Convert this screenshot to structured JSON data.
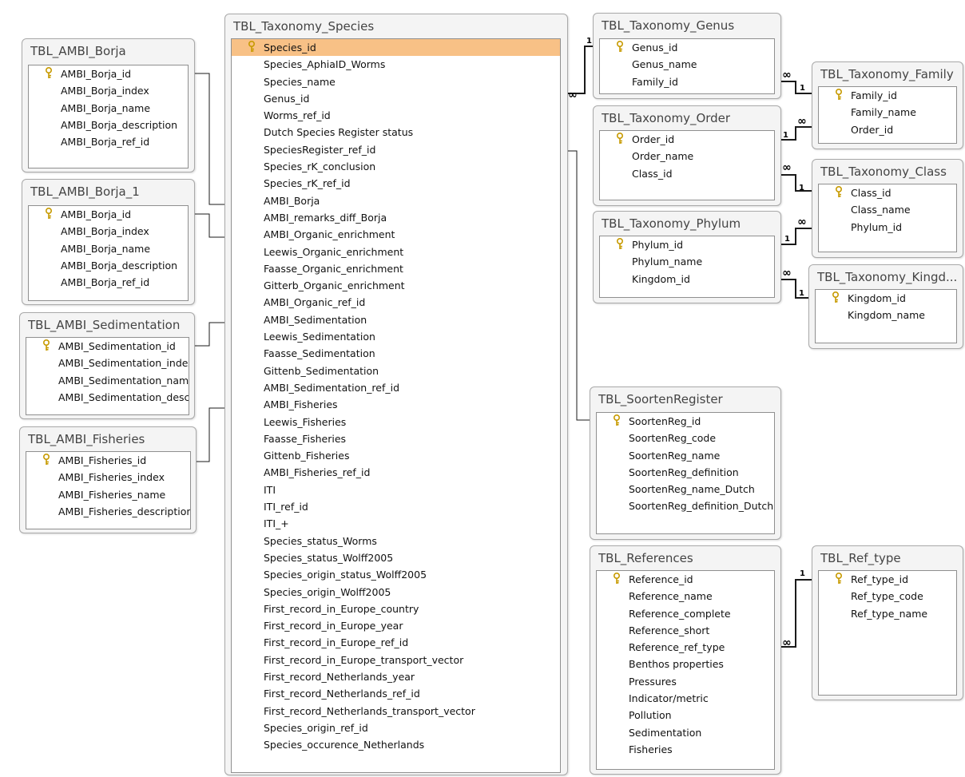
{
  "tables": {
    "species": {
      "title": "TBL_Taxonomy_Species",
      "fields": [
        "Species_id",
        "Species_AphiaID_Worms",
        "Species_name",
        "Genus_id",
        "Worms_ref_id",
        "Dutch Species Register status",
        "SpeciesRegister_ref_id",
        "Species_rK_conclusion",
        "Species_rK_ref_id",
        "AMBI_Borja",
        "AMBI_remarks_diff_Borja",
        "AMBI_Organic_enrichment",
        "Leewis_Organic_enrichment",
        "Faasse_Organic_enrichment",
        "Gitterb_Organic_enrichment",
        "AMBI_Organic_ref_id",
        "AMBI_Sedimentation",
        "Leewis_Sedimentation",
        "Faasse_Sedimentation",
        "Gittenb_Sedimentation",
        "AMBI_Sedimentation_ref_id",
        "AMBI_Fisheries",
        "Leewis_Fisheries",
        "Faasse_Fisheries",
        "Gittenb_Fisheries",
        "AMBI_Fisheries_ref_id",
        "ITI",
        "ITI_ref_id",
        "ITI_+",
        "Species_status_Worms",
        "Species_status_Wolff2005",
        "Species_origin_status_Wolff2005",
        "Species_origin_Wolff2005",
        "First_record_in_Europe_country",
        "First_record_in_Europe_year",
        "First_record_in_Europe_ref_id",
        "First_record_in_Europe_transport_vector",
        "First_record_Netherlands_year",
        "First_record_Netherlands_ref_id",
        "First_record_Netherlands_transport_vector",
        "Species_origin_ref_id",
        "Species_occurence_Netherlands"
      ]
    },
    "ambi_borja": {
      "title": "TBL_AMBI_Borja",
      "fields": [
        "AMBI_Borja_id",
        "AMBI_Borja_index",
        "AMBI_Borja_name",
        "AMBI_Borja_description",
        "AMBI_Borja_ref_id"
      ]
    },
    "ambi_borja_1": {
      "title": "TBL_AMBI_Borja_1",
      "fields": [
        "AMBI_Borja_id",
        "AMBI_Borja_index",
        "AMBI_Borja_name",
        "AMBI_Borja_description",
        "AMBI_Borja_ref_id"
      ]
    },
    "ambi_sedimentation": {
      "title": "TBL_AMBI_Sedimentation",
      "fields": [
        "AMBI_Sedimentation_id",
        "AMBI_Sedimentation_index",
        "AMBI_Sedimentation_name",
        "AMBI_Sedimentation_description"
      ]
    },
    "ambi_fisheries": {
      "title": "TBL_AMBI_Fisheries",
      "fields": [
        "AMBI_Fisheries_id",
        "AMBI_Fisheries_index",
        "AMBI_Fisheries_name",
        "AMBI_Fisheries_description"
      ]
    },
    "genus": {
      "title": "TBL_Taxonomy_Genus",
      "fields": [
        "Genus_id",
        "Genus_name",
        "Family_id"
      ]
    },
    "family": {
      "title": "TBL_Taxonomy_Family",
      "fields": [
        "Family_id",
        "Family_name",
        "Order_id"
      ]
    },
    "order": {
      "title": "TBL_Taxonomy_Order",
      "fields": [
        "Order_id",
        "Order_name",
        "Class_id"
      ]
    },
    "class": {
      "title": "TBL_Taxonomy_Class",
      "fields": [
        "Class_id",
        "Class_name",
        "Phylum_id"
      ]
    },
    "phylum": {
      "title": "TBL_Taxonomy_Phylum",
      "fields": [
        "Phylum_id",
        "Phylum_name",
        "Kingdom_id"
      ]
    },
    "kingdom": {
      "title": "TBL_Taxonomy_Kingd...",
      "fields": [
        "Kingdom_id",
        "Kingdom_name"
      ]
    },
    "soortenregister": {
      "title": "TBL_SoortenRegister",
      "fields": [
        "SoortenReg_id",
        "SoortenReg_code",
        "SoortenReg_name",
        "SoortenReg_definition",
        "SoortenReg_name_Dutch",
        "SoortenReg_definition_Dutch"
      ]
    },
    "references": {
      "title": "TBL_References",
      "fields": [
        "Reference_id",
        "Reference_name",
        "Reference_complete",
        "Reference_short",
        "Reference_ref_type",
        "Benthos properties",
        "Pressures",
        "Indicator/metric",
        "Pollution",
        "Sedimentation",
        "Fisheries"
      ]
    },
    "ref_type": {
      "title": "TBL_Ref_type",
      "fields": [
        "Ref_type_id",
        "Ref_type_code",
        "Ref_type_name"
      ]
    }
  },
  "selected_field": "Species_id",
  "cardinality": {
    "one": "1",
    "many": "∞"
  },
  "colors": {
    "selection": "#f8c186",
    "key": "#e3b400",
    "window": "#f4f4f4"
  }
}
